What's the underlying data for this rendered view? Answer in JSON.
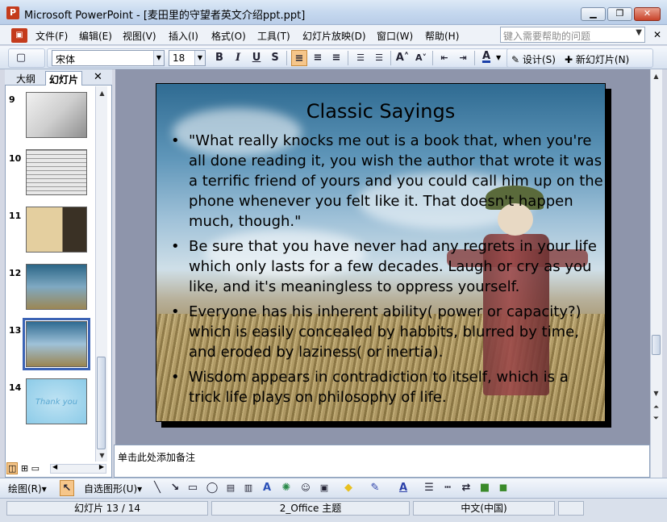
{
  "window": {
    "title": "Microsoft PowerPoint - [麦田里的守望者英文介绍ppt.ppt]",
    "app_icon": "P",
    "controls": [
      "minimize",
      "restore",
      "close"
    ]
  },
  "menubar": {
    "items": [
      "文件(F)",
      "编辑(E)",
      "视图(V)",
      "插入(I)",
      "格式(O)",
      "工具(T)",
      "幻灯片放映(D)",
      "窗口(W)",
      "帮助(H)"
    ],
    "help_placeholder": "键入需要帮助的问题"
  },
  "format_toolbar": {
    "font": "宋体",
    "size": "18",
    "bold": "B",
    "italic": "I",
    "underline": "U",
    "shadow": "S",
    "font_color_letter": "A",
    "design_label": "设计(S)",
    "new_slide_label": "新幻灯片(N)"
  },
  "left_panel": {
    "tabs": [
      "大纲",
      "幻灯片"
    ],
    "active_tab": "幻灯片",
    "slides": [
      {
        "num": "9"
      },
      {
        "num": "10"
      },
      {
        "num": "11"
      },
      {
        "num": "12"
      },
      {
        "num": "13",
        "selected": true
      },
      {
        "num": "14",
        "thumb_text": "Thank you"
      }
    ]
  },
  "slide": {
    "title": "Classic Sayings",
    "bullets": [
      "\"What really knocks me out is a book that, when you're all done reading it, you wish the author that wrote it was a terrific friend of yours and you could call him up on the phone whenever you felt like it. That doesn't happen much, though.\"",
      "Be sure that you have never had any regrets in your life which only lasts for a few decades. Laugh or cry as you like, and it's meaningless to oppress yourself.",
      "Everyone has his inherent ability( power or capacity?) which is easily concealed by habbits, blurred by time, and eroded by laziness( or inertia).",
      "Wisdom appears in contradiction to itself, which is a trick life plays on philosophy of life."
    ]
  },
  "notes": {
    "placeholder": "单击此处添加备注"
  },
  "drawing_toolbar": {
    "draw_label": "绘图(R)",
    "autoshapes_label": "自选图形(U)"
  },
  "statusbar": {
    "slide_position": "幻灯片 13 / 14",
    "theme": "2_Office 主题",
    "language": "中文(中国)"
  },
  "colors": {
    "accent_selected": "#3b63b5",
    "toolbar_bg": "#dbe5f3",
    "stage_bg": "#8e95ab"
  }
}
